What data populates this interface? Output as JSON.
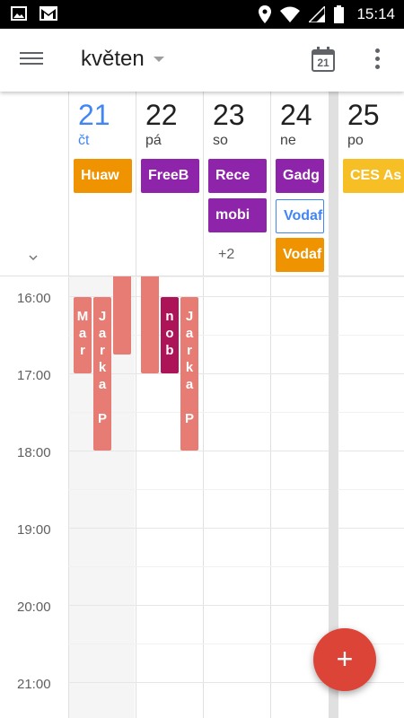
{
  "status_bar": {
    "time": "15:14",
    "icons": [
      "image-icon",
      "gmail-icon",
      "location-icon",
      "wifi-icon",
      "signal-icon",
      "battery-icon"
    ]
  },
  "app_bar": {
    "month_label": "květen",
    "today_icon_day": "21",
    "icons": [
      "menu-icon",
      "calendar-today-icon",
      "more-vert-icon"
    ]
  },
  "days": [
    {
      "num": "21",
      "name": "čt",
      "today": true
    },
    {
      "num": "22",
      "name": "pá",
      "today": false
    },
    {
      "num": "23",
      "name": "so",
      "today": false
    },
    {
      "num": "24",
      "name": "ne",
      "today": false
    },
    {
      "num": "25",
      "name": "po",
      "today": false
    }
  ],
  "all_day_events": {
    "d21": [
      {
        "title": "Huaw",
        "color": "#f09300"
      }
    ],
    "d22": [
      {
        "title": "FreeB",
        "color": "#8e24aa"
      }
    ],
    "d23": [
      {
        "title": "Rece",
        "color": "#8e24aa"
      },
      {
        "title": "mobi",
        "color": "#8e24aa"
      }
    ],
    "d23_more": "+2",
    "d24": [
      {
        "title": "Gadg",
        "color": "#8e24aa"
      },
      {
        "title": "Vodaf",
        "color": "#4285f4",
        "outline": true
      },
      {
        "title": "Vodaf",
        "color": "#f09300"
      }
    ],
    "d25": [
      {
        "title": "CES As",
        "color": "#f6bf26"
      }
    ]
  },
  "time_labels": [
    "16:00",
    "17:00",
    "18:00",
    "19:00",
    "20:00",
    "21:00"
  ],
  "timed_events": [
    {
      "text": "M\na\nr",
      "color": "#e67c73"
    },
    {
      "text": "J\na\nr\nk\na\n\nP",
      "color": "#e67c73"
    },
    {
      "text": "",
      "color": "#e67c73"
    },
    {
      "text": "",
      "color": "#e67c73"
    },
    {
      "text": "n\no\nb",
      "color": "#ad1457"
    },
    {
      "text": "J\na\nr\nk\na\n\nP",
      "color": "#e67c73"
    }
  ],
  "fab": {
    "label": "+"
  },
  "colors": {
    "accent": "#4285f4",
    "fab": "#db4437"
  }
}
